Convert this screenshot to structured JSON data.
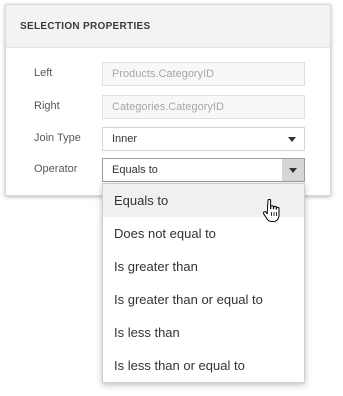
{
  "panel": {
    "title": "SELECTION PROPERTIES",
    "fields": [
      {
        "label": "Left",
        "value": "Products.CategoryID",
        "state": "disabled"
      },
      {
        "label": "Right",
        "value": "Categories.CategoryID",
        "state": "disabled"
      },
      {
        "label": "Join Type",
        "value": "Inner",
        "state": "combo"
      },
      {
        "label": "Operator",
        "value": "Equals to",
        "state": "open"
      }
    ]
  },
  "dropdown": {
    "options": [
      "Equals to",
      "Does not equal to",
      "Is greater than",
      "Is greater than or equal to",
      "Is less than",
      "Is less than or equal to"
    ],
    "hovered_index": 0
  },
  "icons": {
    "dropdown_arrow": "chevron-down-icon",
    "cursor": "hand-pointer-icon"
  }
}
